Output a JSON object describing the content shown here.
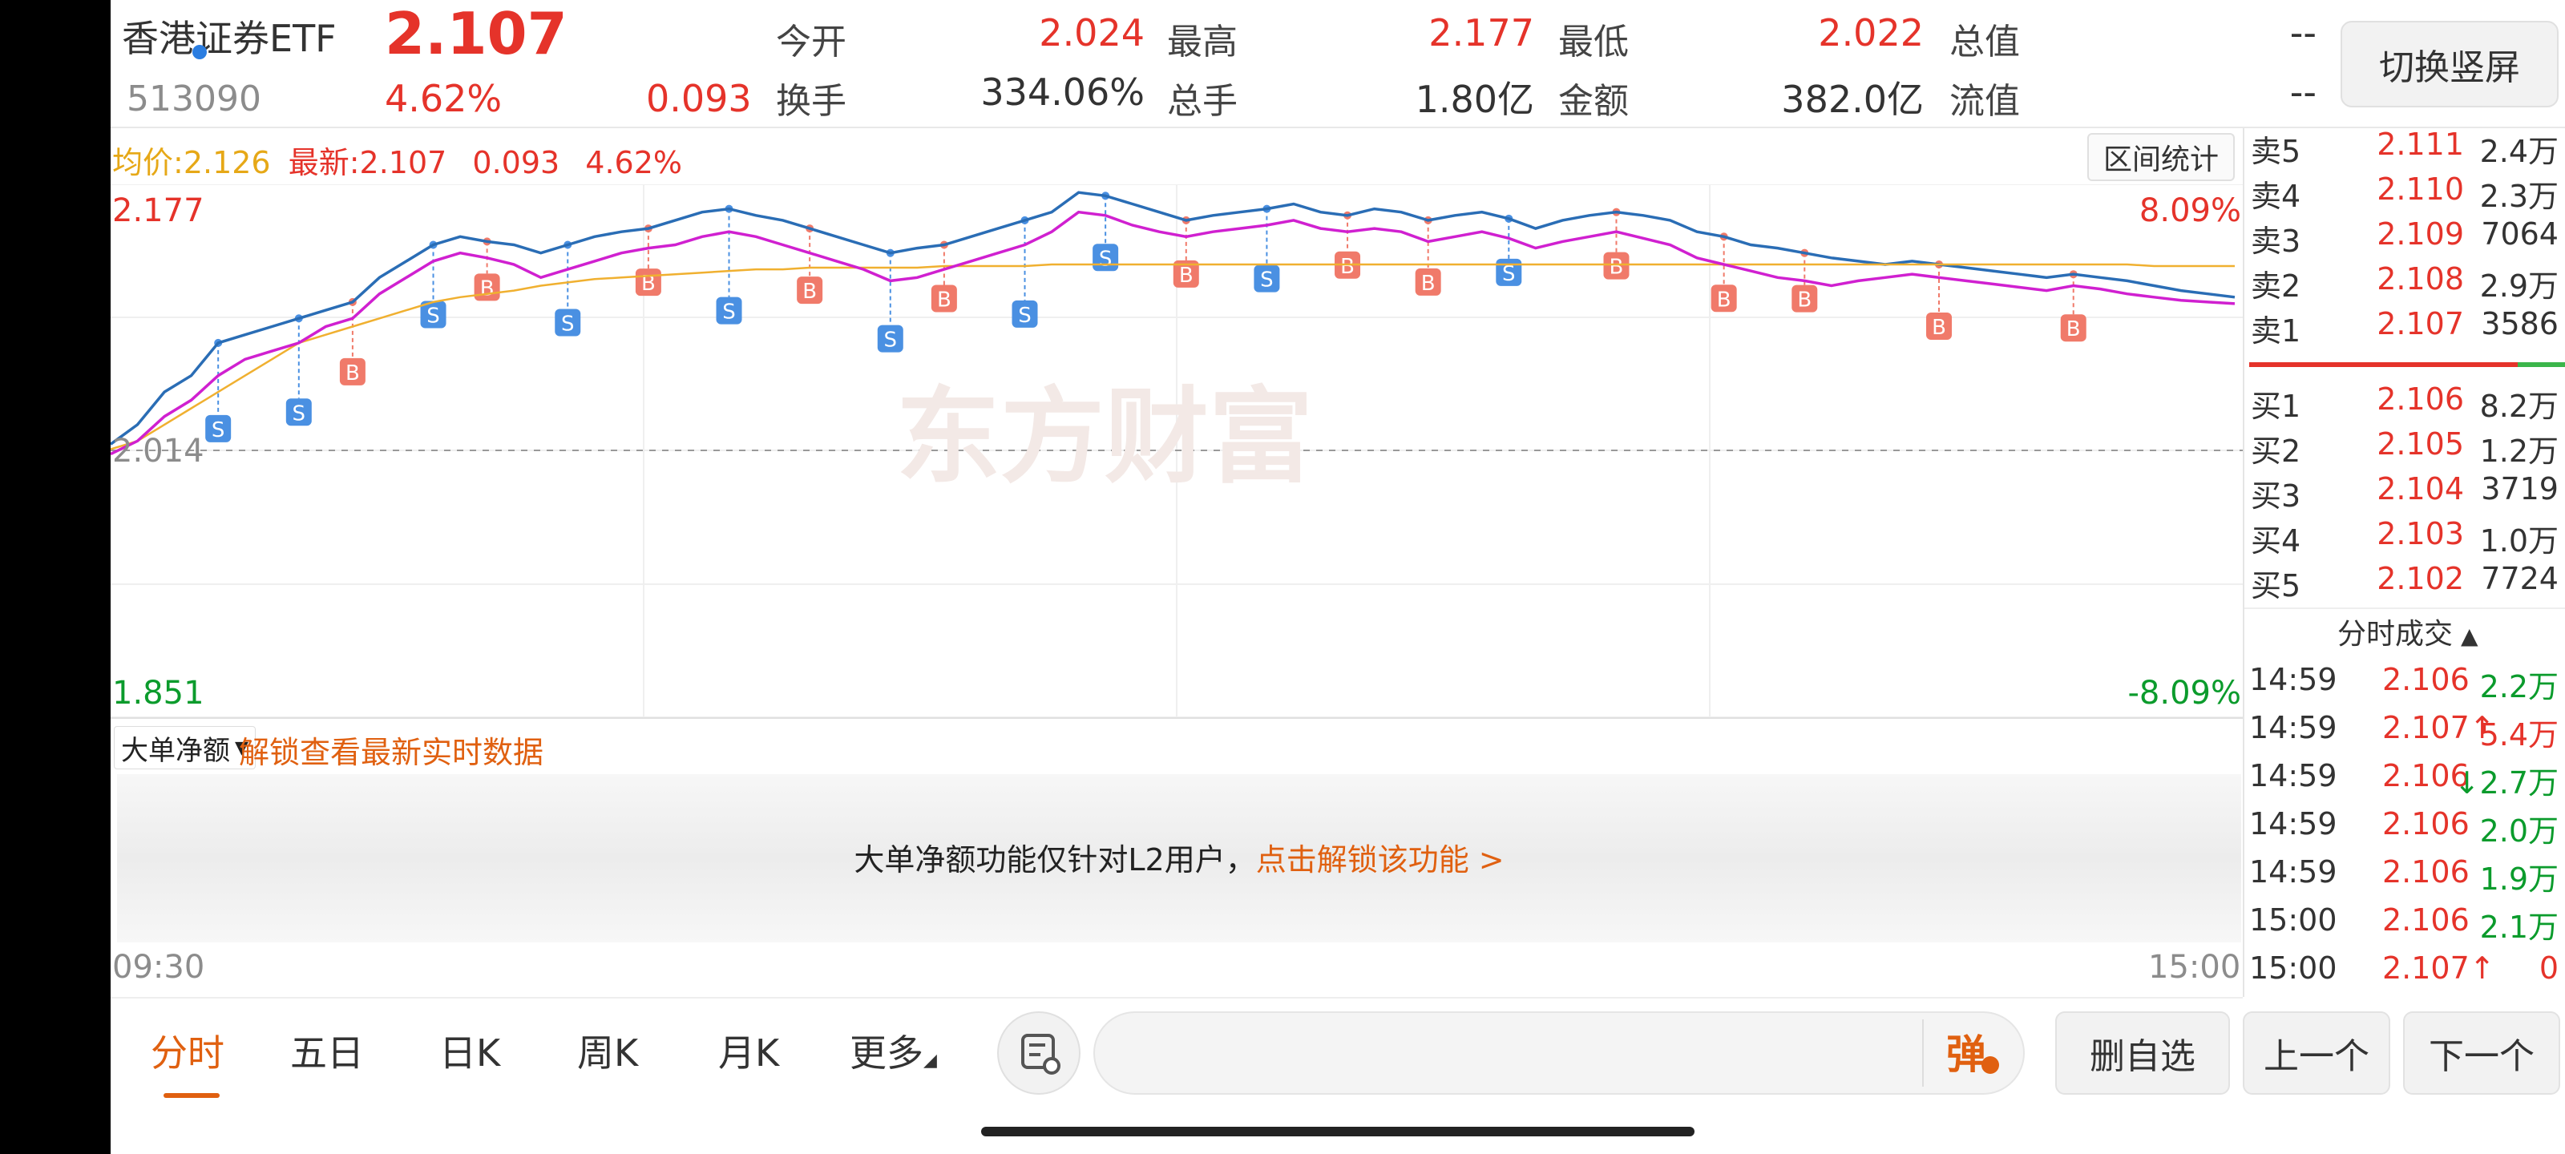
{
  "header": {
    "name": "香港证券ETF",
    "code": "513090",
    "price": "2.107",
    "change_pct": "4.62%",
    "change": "0.093",
    "stats": [
      {
        "label": "今开",
        "value": "2.024",
        "color": "red"
      },
      {
        "label": "最高",
        "value": "2.177",
        "color": "red"
      },
      {
        "label": "最低",
        "value": "2.022",
        "color": "red"
      },
      {
        "label": "总值",
        "value": "--",
        "color": "dark"
      },
      {
        "label": "换手",
        "value": "334.06%",
        "color": "dark"
      },
      {
        "label": "总手",
        "value": "1.80亿",
        "color": "dark"
      },
      {
        "label": "金额",
        "value": "382.0亿",
        "color": "dark"
      },
      {
        "label": "流值",
        "value": "--",
        "color": "dark"
      }
    ],
    "switch_button": "切换竖屏"
  },
  "chart": {
    "avg_label": "均价:",
    "avg_value": "2.126",
    "latest_label": "最新:",
    "latest_value": "2.107",
    "latest_change": "0.093",
    "latest_pct": "4.62%",
    "interval_button": "区间统计",
    "y_high": "2.177",
    "y_mid": "2.014",
    "y_low": "1.851",
    "pct_high": "8.09%",
    "pct_low": "-8.09%",
    "watermark": "东方财富",
    "time_start": "09:30",
    "time_end": "15:00"
  },
  "chart_data": {
    "type": "line",
    "title": "",
    "ylim": [
      1.851,
      2.177
    ],
    "x_range": [
      "09:30",
      "15:00"
    ],
    "prev_close": 2.014,
    "grid": true,
    "colors": {
      "price": "#2a6db5",
      "avg": "#f0b030",
      "line3": "#d020d0"
    },
    "series": [
      {
        "values": [
          2.018,
          2.03,
          2.05,
          2.06,
          2.08,
          2.085,
          2.09,
          2.095,
          2.1,
          2.105,
          2.12,
          2.13,
          2.14,
          2.145,
          2.142,
          2.14,
          2.135,
          2.14,
          2.145,
          2.148,
          2.15,
          2.155,
          2.16,
          2.162,
          2.158,
          2.155,
          2.15,
          2.145,
          2.14,
          2.135,
          2.138,
          2.14,
          2.145,
          2.15,
          2.155,
          2.16,
          2.172,
          2.17,
          2.165,
          2.16,
          2.155,
          2.158,
          2.16,
          2.162,
          2.165,
          2.16,
          2.158,
          2.162,
          2.16,
          2.155,
          2.158,
          2.16,
          2.156,
          2.15,
          2.155,
          2.158,
          2.16,
          2.158,
          2.155,
          2.148,
          2.145,
          2.14,
          2.138,
          2.135,
          2.132,
          2.13,
          2.128,
          2.13,
          2.128,
          2.126,
          2.124,
          2.122,
          2.12,
          2.122,
          2.12,
          2.118,
          2.115,
          2.112,
          2.11,
          2.108
        ]
      },
      {
        "values": [
          2.015,
          2.02,
          2.03,
          2.04,
          2.05,
          2.06,
          2.07,
          2.08,
          2.085,
          2.09,
          2.095,
          2.1,
          2.105,
          2.108,
          2.11,
          2.112,
          2.115,
          2.117,
          2.119,
          2.12,
          2.121,
          2.122,
          2.123,
          2.124,
          2.125,
          2.125,
          2.126,
          2.126,
          2.126,
          2.126,
          2.126,
          2.127,
          2.127,
          2.127,
          2.127,
          2.128,
          2.128,
          2.128,
          2.128,
          2.128,
          2.128,
          2.128,
          2.128,
          2.128,
          2.128,
          2.128,
          2.128,
          2.128,
          2.128,
          2.128,
          2.128,
          2.128,
          2.128,
          2.128,
          2.128,
          2.128,
          2.128,
          2.128,
          2.128,
          2.128,
          2.128,
          2.128,
          2.128,
          2.128,
          2.128,
          2.128,
          2.128,
          2.128,
          2.128,
          2.128,
          2.128,
          2.128,
          2.128,
          2.128,
          2.128,
          2.128,
          2.127,
          2.127,
          2.127,
          2.127
        ]
      },
      {
        "values": [
          2.012,
          2.02,
          2.035,
          2.045,
          2.06,
          2.07,
          2.075,
          2.08,
          2.09,
          2.095,
          2.11,
          2.12,
          2.13,
          2.135,
          2.132,
          2.128,
          2.12,
          2.125,
          2.13,
          2.135,
          2.138,
          2.14,
          2.145,
          2.148,
          2.145,
          2.14,
          2.135,
          2.13,
          2.125,
          2.118,
          2.12,
          2.125,
          2.13,
          2.135,
          2.14,
          2.148,
          2.16,
          2.158,
          2.152,
          2.148,
          2.145,
          2.148,
          2.15,
          2.152,
          2.155,
          2.15,
          2.148,
          2.15,
          2.148,
          2.142,
          2.145,
          2.148,
          2.144,
          2.138,
          2.142,
          2.145,
          2.148,
          2.144,
          2.14,
          2.132,
          2.128,
          2.124,
          2.12,
          2.118,
          2.115,
          2.118,
          2.12,
          2.122,
          2.12,
          2.118,
          2.116,
          2.114,
          2.112,
          2.115,
          2.113,
          2.11,
          2.108,
          2.106,
          2.105,
          2.104
        ]
      }
    ]
  },
  "sub_panel": {
    "dropdown": "大单净额",
    "unlock_link": "解锁查看最新实时数据",
    "notice": "大单净额功能仅针对L2用户，",
    "notice_link": "点击解锁该功能 >"
  },
  "orderbook": {
    "sell": [
      {
        "label": "卖5",
        "price": "2.111",
        "vol": "2.4万"
      },
      {
        "label": "卖4",
        "price": "2.110",
        "vol": "2.3万"
      },
      {
        "label": "卖3",
        "price": "2.109",
        "vol": "7064"
      },
      {
        "label": "卖2",
        "price": "2.108",
        "vol": "2.9万"
      },
      {
        "label": "卖1",
        "price": "2.107",
        "vol": "3586"
      }
    ],
    "buy": [
      {
        "label": "买1",
        "price": "2.106",
        "vol": "8.2万"
      },
      {
        "label": "买2",
        "price": "2.105",
        "vol": "1.2万"
      },
      {
        "label": "买3",
        "price": "2.104",
        "vol": "3719"
      },
      {
        "label": "买4",
        "price": "2.103",
        "vol": "1.0万"
      },
      {
        "label": "买5",
        "price": "2.102",
        "vol": "7724"
      }
    ]
  },
  "trades": {
    "title": "分时成交",
    "rows": [
      {
        "time": "14:59",
        "price": "2.106",
        "vol": "2.2万",
        "arrow": ""
      },
      {
        "time": "14:59",
        "price": "2.107↑",
        "vol": "5.4万",
        "arrow": "up"
      },
      {
        "time": "14:59",
        "price": "2.106",
        "vol": "↓2.7万",
        "arrow": "down"
      },
      {
        "time": "14:59",
        "price": "2.106",
        "vol": "2.0万",
        "arrow": ""
      },
      {
        "time": "14:59",
        "price": "2.106",
        "vol": "1.9万",
        "arrow": ""
      },
      {
        "time": "15:00",
        "price": "2.106",
        "vol": "2.1万",
        "arrow": ""
      },
      {
        "time": "15:00",
        "price": "2.107↑",
        "vol": "0",
        "arrow": "up"
      }
    ]
  },
  "bottom": {
    "tabs": [
      "分时",
      "五日",
      "日K",
      "周K",
      "月K",
      "更多"
    ],
    "danmu": "弹",
    "delete_button": "删自选",
    "prev_button": "上一个",
    "next_button": "下一个"
  }
}
